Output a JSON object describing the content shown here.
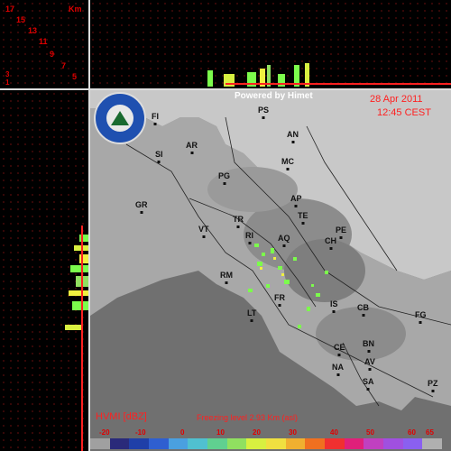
{
  "km_scale": {
    "unit": "Km",
    "labels": [
      "17",
      "15",
      "13",
      "11",
      "9",
      "7",
      "5",
      "3",
      "1"
    ]
  },
  "header": {
    "powered_by": "Powered by Himet",
    "date": "28 Apr 2011",
    "time": "12:45 CEST"
  },
  "logo": {
    "text": "PROTEZIONE CIVILE REGIONE ABRUZZO"
  },
  "cities": [
    {
      "code": "PS"
    },
    {
      "code": "FI"
    },
    {
      "code": "AN"
    },
    {
      "code": "AR"
    },
    {
      "code": "SI"
    },
    {
      "code": "MC"
    },
    {
      "code": "PG"
    },
    {
      "code": "AP"
    },
    {
      "code": "GR"
    },
    {
      "code": "TE"
    },
    {
      "code": "TR"
    },
    {
      "code": "PE"
    },
    {
      "code": "VT"
    },
    {
      "code": "RI"
    },
    {
      "code": "AQ"
    },
    {
      "code": "CH"
    },
    {
      "code": "RM"
    },
    {
      "code": "FR"
    },
    {
      "code": "IS"
    },
    {
      "code": "CB"
    },
    {
      "code": "FG"
    },
    {
      "code": "LT"
    },
    {
      "code": "CE"
    },
    {
      "code": "BN"
    },
    {
      "code": "AV"
    },
    {
      "code": "NA"
    },
    {
      "code": "SA"
    },
    {
      "code": "PZ"
    }
  ],
  "footer": {
    "product": "HVMI [dBZ]",
    "freezing_level": "Freezing level  2.93 Km (asl)"
  },
  "color_scale": {
    "ticks": [
      "-20",
      "-10",
      "0",
      "10",
      "20",
      "30",
      "40",
      "50",
      "60",
      "65"
    ],
    "colors": [
      "#a0a0a0",
      "#2a2a7a",
      "#1f3fa8",
      "#2f5fd0",
      "#4aa0e0",
      "#50c0d0",
      "#60d090",
      "#90e060",
      "#d8f040",
      "#f0e040",
      "#f0b030",
      "#f07020",
      "#f03030",
      "#e0207a",
      "#c040c0",
      "#a050e0",
      "#8a60f0",
      "#b0b0b0"
    ]
  },
  "colors": {
    "accent_red": "#ff2020",
    "echo_green": "#7cfc4c",
    "echo_yellow": "#f0f040"
  }
}
